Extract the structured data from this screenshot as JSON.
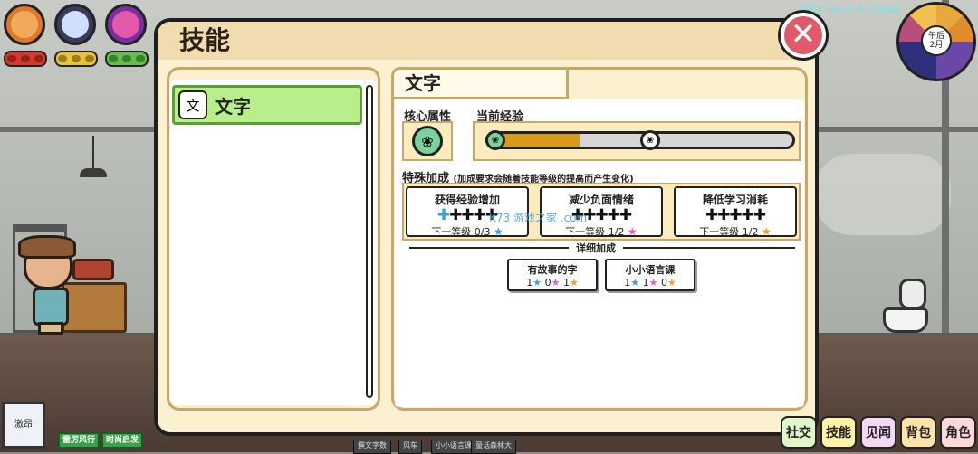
{
  "version": "测试 v0.6.6 Steam",
  "status_bars": [
    {
      "name": "health",
      "color": "#d8392b"
    },
    {
      "name": "energy",
      "color": "#e8c23a"
    },
    {
      "name": "mood",
      "color": "#5ec24a"
    }
  ],
  "clock": {
    "period": "午后",
    "date": "2月"
  },
  "panel": {
    "title": "技能",
    "skill_list": [
      {
        "label": "文字",
        "icon": "文",
        "selected": true
      }
    ],
    "detail": {
      "skill_name": "文字",
      "core_attr_label": "核心属性",
      "current_exp_label": "当前经验",
      "exp_progress": 0.3,
      "special_bonus_title": "特殊加成",
      "special_bonus_subtitle": "(加成要求会随着技能等级的提高而产生变化)",
      "bonuses": [
        {
          "name": "获得经验增加",
          "next": "下一等级 0/3",
          "star_color": "#3aa0e0"
        },
        {
          "name": "减少负面情绪",
          "next": "下一等级 1/2",
          "star_color": "#e060c0"
        },
        {
          "name": "降低学习消耗",
          "next": "下一等级 1/2",
          "star_color": "#f0a020"
        }
      ],
      "detail_bonus_label": "详细加成",
      "detail_bonuses": [
        {
          "name": "有故事的字",
          "v1": "1",
          "v2": "0",
          "v3": "1"
        },
        {
          "name": "小小语言课",
          "v1": "1",
          "v2": "1",
          "v3": "0"
        }
      ]
    }
  },
  "watermark": "K73 游戏之家 .com",
  "bottom": {
    "avatar_label": "激昂",
    "tags": [
      "雷厉风行",
      "时尚启发"
    ],
    "mini_tabs": [
      "撰文字数",
      "风车",
      "小小语言课",
      "童话森林大"
    ],
    "menu": [
      {
        "label": "社交",
        "color": "#dff6c8"
      },
      {
        "label": "技能",
        "color": "#fff4a8"
      },
      {
        "label": "见闻",
        "color": "#f4d8f4"
      },
      {
        "label": "背包",
        "color": "#ffe3a8"
      },
      {
        "label": "角色",
        "color": "#ffd8d8"
      }
    ]
  }
}
